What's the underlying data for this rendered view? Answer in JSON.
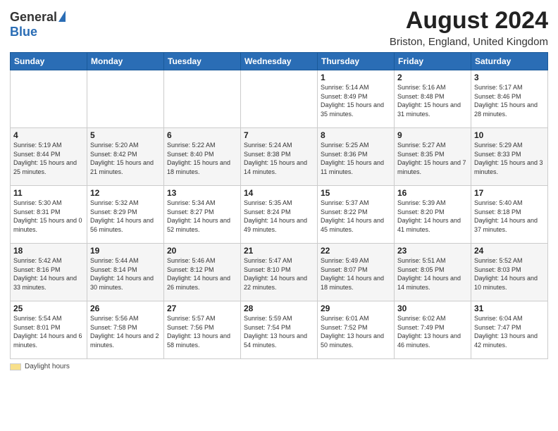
{
  "logo": {
    "general": "General",
    "blue": "Blue"
  },
  "header": {
    "month_year": "August 2024",
    "location": "Briston, England, United Kingdom"
  },
  "weekdays": [
    "Sunday",
    "Monday",
    "Tuesday",
    "Wednesday",
    "Thursday",
    "Friday",
    "Saturday"
  ],
  "weeks": [
    [
      {
        "day": "",
        "text": ""
      },
      {
        "day": "",
        "text": ""
      },
      {
        "day": "",
        "text": ""
      },
      {
        "day": "",
        "text": ""
      },
      {
        "day": "1",
        "text": "Sunrise: 5:14 AM\nSunset: 8:49 PM\nDaylight: 15 hours and 35 minutes."
      },
      {
        "day": "2",
        "text": "Sunrise: 5:16 AM\nSunset: 8:48 PM\nDaylight: 15 hours and 31 minutes."
      },
      {
        "day": "3",
        "text": "Sunrise: 5:17 AM\nSunset: 8:46 PM\nDaylight: 15 hours and 28 minutes."
      }
    ],
    [
      {
        "day": "4",
        "text": "Sunrise: 5:19 AM\nSunset: 8:44 PM\nDaylight: 15 hours and 25 minutes."
      },
      {
        "day": "5",
        "text": "Sunrise: 5:20 AM\nSunset: 8:42 PM\nDaylight: 15 hours and 21 minutes."
      },
      {
        "day": "6",
        "text": "Sunrise: 5:22 AM\nSunset: 8:40 PM\nDaylight: 15 hours and 18 minutes."
      },
      {
        "day": "7",
        "text": "Sunrise: 5:24 AM\nSunset: 8:38 PM\nDaylight: 15 hours and 14 minutes."
      },
      {
        "day": "8",
        "text": "Sunrise: 5:25 AM\nSunset: 8:36 PM\nDaylight: 15 hours and 11 minutes."
      },
      {
        "day": "9",
        "text": "Sunrise: 5:27 AM\nSunset: 8:35 PM\nDaylight: 15 hours and 7 minutes."
      },
      {
        "day": "10",
        "text": "Sunrise: 5:29 AM\nSunset: 8:33 PM\nDaylight: 15 hours and 3 minutes."
      }
    ],
    [
      {
        "day": "11",
        "text": "Sunrise: 5:30 AM\nSunset: 8:31 PM\nDaylight: 15 hours and 0 minutes."
      },
      {
        "day": "12",
        "text": "Sunrise: 5:32 AM\nSunset: 8:29 PM\nDaylight: 14 hours and 56 minutes."
      },
      {
        "day": "13",
        "text": "Sunrise: 5:34 AM\nSunset: 8:27 PM\nDaylight: 14 hours and 52 minutes."
      },
      {
        "day": "14",
        "text": "Sunrise: 5:35 AM\nSunset: 8:24 PM\nDaylight: 14 hours and 49 minutes."
      },
      {
        "day": "15",
        "text": "Sunrise: 5:37 AM\nSunset: 8:22 PM\nDaylight: 14 hours and 45 minutes."
      },
      {
        "day": "16",
        "text": "Sunrise: 5:39 AM\nSunset: 8:20 PM\nDaylight: 14 hours and 41 minutes."
      },
      {
        "day": "17",
        "text": "Sunrise: 5:40 AM\nSunset: 8:18 PM\nDaylight: 14 hours and 37 minutes."
      }
    ],
    [
      {
        "day": "18",
        "text": "Sunrise: 5:42 AM\nSunset: 8:16 PM\nDaylight: 14 hours and 33 minutes."
      },
      {
        "day": "19",
        "text": "Sunrise: 5:44 AM\nSunset: 8:14 PM\nDaylight: 14 hours and 30 minutes."
      },
      {
        "day": "20",
        "text": "Sunrise: 5:46 AM\nSunset: 8:12 PM\nDaylight: 14 hours and 26 minutes."
      },
      {
        "day": "21",
        "text": "Sunrise: 5:47 AM\nSunset: 8:10 PM\nDaylight: 14 hours and 22 minutes."
      },
      {
        "day": "22",
        "text": "Sunrise: 5:49 AM\nSunset: 8:07 PM\nDaylight: 14 hours and 18 minutes."
      },
      {
        "day": "23",
        "text": "Sunrise: 5:51 AM\nSunset: 8:05 PM\nDaylight: 14 hours and 14 minutes."
      },
      {
        "day": "24",
        "text": "Sunrise: 5:52 AM\nSunset: 8:03 PM\nDaylight: 14 hours and 10 minutes."
      }
    ],
    [
      {
        "day": "25",
        "text": "Sunrise: 5:54 AM\nSunset: 8:01 PM\nDaylight: 14 hours and 6 minutes."
      },
      {
        "day": "26",
        "text": "Sunrise: 5:56 AM\nSunset: 7:58 PM\nDaylight: 14 hours and 2 minutes."
      },
      {
        "day": "27",
        "text": "Sunrise: 5:57 AM\nSunset: 7:56 PM\nDaylight: 13 hours and 58 minutes."
      },
      {
        "day": "28",
        "text": "Sunrise: 5:59 AM\nSunset: 7:54 PM\nDaylight: 13 hours and 54 minutes."
      },
      {
        "day": "29",
        "text": "Sunrise: 6:01 AM\nSunset: 7:52 PM\nDaylight: 13 hours and 50 minutes."
      },
      {
        "day": "30",
        "text": "Sunrise: 6:02 AM\nSunset: 7:49 PM\nDaylight: 13 hours and 46 minutes."
      },
      {
        "day": "31",
        "text": "Sunrise: 6:04 AM\nSunset: 7:47 PM\nDaylight: 13 hours and 42 minutes."
      }
    ]
  ],
  "footer": {
    "label": "Daylight hours"
  }
}
